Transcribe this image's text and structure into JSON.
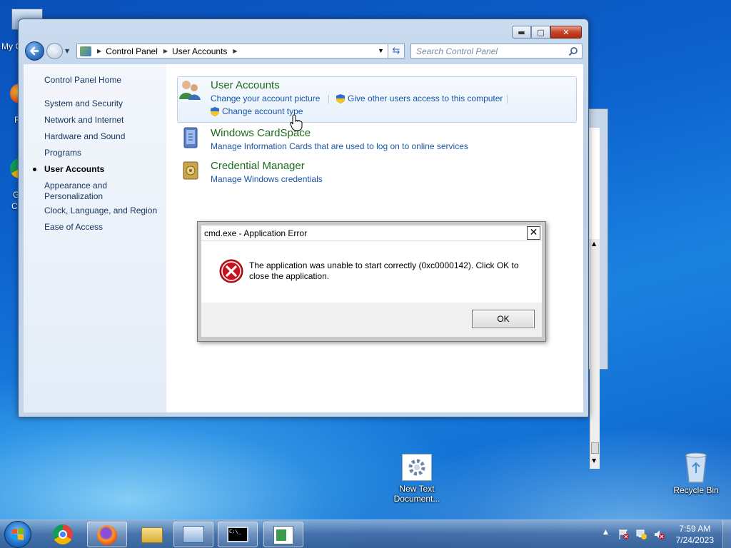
{
  "desktop": {
    "partial_icons": [
      {
        "label": "My C"
      },
      {
        "label": "F"
      },
      {
        "label": "G"
      },
      {
        "label": "C"
      }
    ],
    "icons": [
      {
        "label_line1": "New Text",
        "label_line2": "Document...",
        "icon": "settings-file-icon"
      },
      {
        "label_line1": "Recycle Bin",
        "label_line2": "",
        "icon": "recycle-bin-icon"
      }
    ]
  },
  "window": {
    "address": {
      "crumbs": [
        "Control Panel",
        "User Accounts"
      ]
    },
    "search_placeholder": "Search Control Panel",
    "left_nav": {
      "home": "Control Panel Home",
      "items": [
        "System and Security",
        "Network and Internet",
        "Hardware and Sound",
        "Programs",
        "User Accounts",
        "Appearance and Personalization",
        "Clock, Language, and Region",
        "Ease of Access"
      ],
      "appearance_line1": "Appearance and",
      "appearance_line2": "Personalization",
      "selected": "User Accounts"
    },
    "categories": [
      {
        "title": "User Accounts",
        "links": [
          "Change your account picture",
          "Give other users access to this computer",
          "Change account type"
        ]
      },
      {
        "title": "Windows CardSpace",
        "links": [
          "Manage Information Cards that are used to log on to online services"
        ]
      },
      {
        "title": "Credential Manager",
        "links": [
          "Manage Windows credentials"
        ]
      }
    ]
  },
  "dialog": {
    "title": "cmd.exe - Application Error",
    "message_line1": "The application was unable to start correctly (0xc0000142). Click OK to",
    "message_line2": "close the application.",
    "ok_label": "OK",
    "close_glyph": "✕"
  },
  "taskbar": {
    "apps": [
      "Start",
      "Google Chrome",
      "Firefox",
      "Windows Explorer",
      "Control Panel",
      "Command Prompt",
      "Application Error"
    ],
    "time": "7:59 AM",
    "date": "7/24/2023"
  },
  "colors": {
    "link": "#1a56a8",
    "category_title": "#1d6b1d",
    "error_red": "#c8141e"
  }
}
